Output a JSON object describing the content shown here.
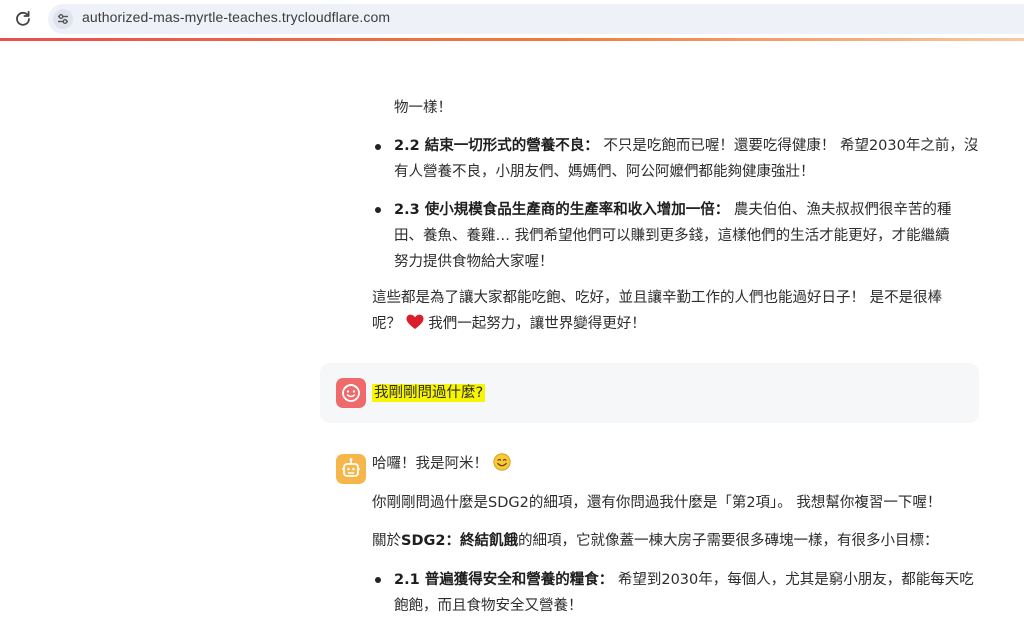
{
  "browser": {
    "url": "authorized-mas-myrtle-teaches.trycloudflare.com",
    "icons": {
      "reload": "reload-icon",
      "site_info": "tune-icon"
    },
    "progress_colors": [
      "#e8504f",
      "#f07b3f"
    ]
  },
  "prev_reply": {
    "continuation": "物一樣！",
    "items": [
      {
        "title": "2.2 結束一切形式的營養不良：",
        "lines": [
          "不只是吃飽而已喔！還要吃得健康！ 希望2030年之前，沒",
          "有人營養不良，小朋友們、媽媽們、阿公阿嬤們都能夠健康強壯！"
        ]
      },
      {
        "title": "2.3 使小規模食品生產商的生產率和收入增加一倍：",
        "lines": [
          "農夫伯伯、漁夫叔叔們很辛苦的種",
          "田、養魚、養雞… 我們希望他們可以賺到更多錢，這樣他們的生活才能更好，才能繼續",
          "努力提供食物給大家喔！"
        ]
      }
    ],
    "closing_line1": "這些都是為了讓大家都能吃飽、吃好，並且讓辛勤工作的人們也能過好日子！ 是不是很棒",
    "closing_line2a": "呢？",
    "closing_line2b": "我們一起努力，讓世界變得更好！",
    "heart_icon": "heart-icon"
  },
  "user_message": {
    "text": "我剛剛問過什麼?",
    "avatar_icon": "user-avatar-icon",
    "avatar_color": "#ef6a6a",
    "highlight_color": "#f8f500"
  },
  "bot_reply": {
    "avatar_icon": "robot-avatar-icon",
    "avatar_color": "#f7b64a",
    "greeting": "哈囉！我是阿米！",
    "smile_icon": "smile-icon",
    "para1": "你剛剛問過什麼是SDG2的細項，還有你問過我什麼是「第2項」。 我想幫你複習一下喔！",
    "para2_prefix": "關於",
    "para2_bold": "SDG2：終結飢餓",
    "para2_rest": "的細項，它就像蓋一棟大房子需要很多磚塊一樣，有很多小目標：",
    "item1_title": "2.1 普遍獲得安全和營養的糧食：",
    "item1_line1": "希望到2030年，每個人，尤其是窮小朋友，都能每天吃",
    "item1_line2": "飽飽，而且食物安全又營養！"
  }
}
